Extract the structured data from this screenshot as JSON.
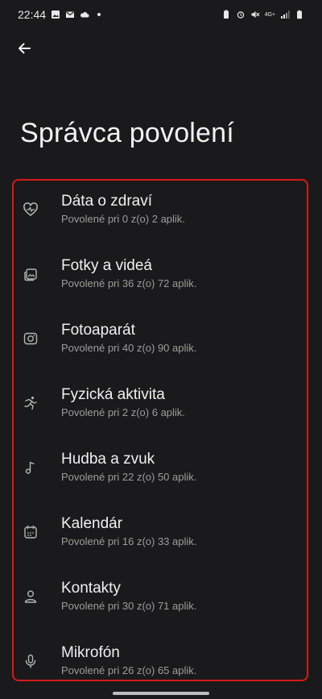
{
  "status_bar": {
    "time": "22:44",
    "network": "4G+"
  },
  "page": {
    "title": "Správca povolení"
  },
  "items": [
    {
      "title": "Dáta o zdraví",
      "subtitle": "Povolené pri 0 z(o) 2 aplik.",
      "icon": "health-heart-icon"
    },
    {
      "title": "Fotky a videá",
      "subtitle": "Povolené pri 36 z(o) 72 aplik.",
      "icon": "photos-icon"
    },
    {
      "title": "Fotoaparát",
      "subtitle": "Povolené pri 40 z(o) 90 aplik.",
      "icon": "camera-icon"
    },
    {
      "title": "Fyzická aktivita",
      "subtitle": "Povolené pri 2 z(o) 6 aplik.",
      "icon": "running-icon"
    },
    {
      "title": "Hudba a zvuk",
      "subtitle": "Povolené pri 22 z(o) 50 aplik.",
      "icon": "music-note-icon"
    },
    {
      "title": "Kalendár",
      "subtitle": "Povolené pri 16 z(o) 33 aplik.",
      "icon": "calendar-icon"
    },
    {
      "title": "Kontakty",
      "subtitle": "Povolené pri 30 z(o) 71 aplik.",
      "icon": "person-icon"
    },
    {
      "title": "Mikrofón",
      "subtitle": "Povolené pri 26 z(o) 65 aplik.",
      "icon": "microphone-icon"
    }
  ],
  "colors": {
    "background": "#1a1a1c",
    "highlight_border": "#d61a1a",
    "primary_text": "#f0f0f0",
    "secondary_text": "#9c9c9c"
  }
}
